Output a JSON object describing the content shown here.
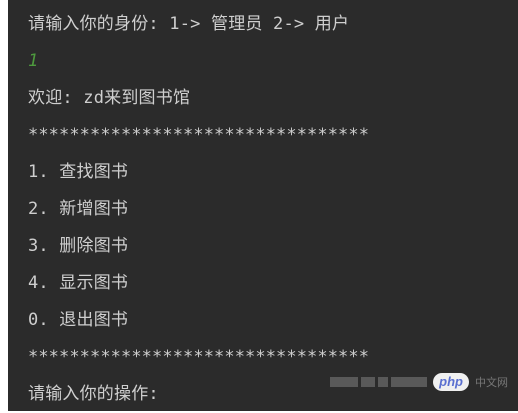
{
  "console": {
    "lines": [
      "请输入你的身份: 1-> 管理员 2-> 用户",
      "1",
      "欢迎: zd来到图书馆",
      "*********************************",
      "1. 查找图书",
      "2. 新增图书",
      "3. 删除图书",
      "4. 显示图书",
      "0. 退出图书",
      "*********************************",
      "请输入你的操作:"
    ]
  },
  "watermark": {
    "logo": "php",
    "cn": "中文网"
  },
  "colors": {
    "background": "#2b2b2b",
    "text": "#cfcfcf",
    "input_echo": "#4e9a3e"
  }
}
